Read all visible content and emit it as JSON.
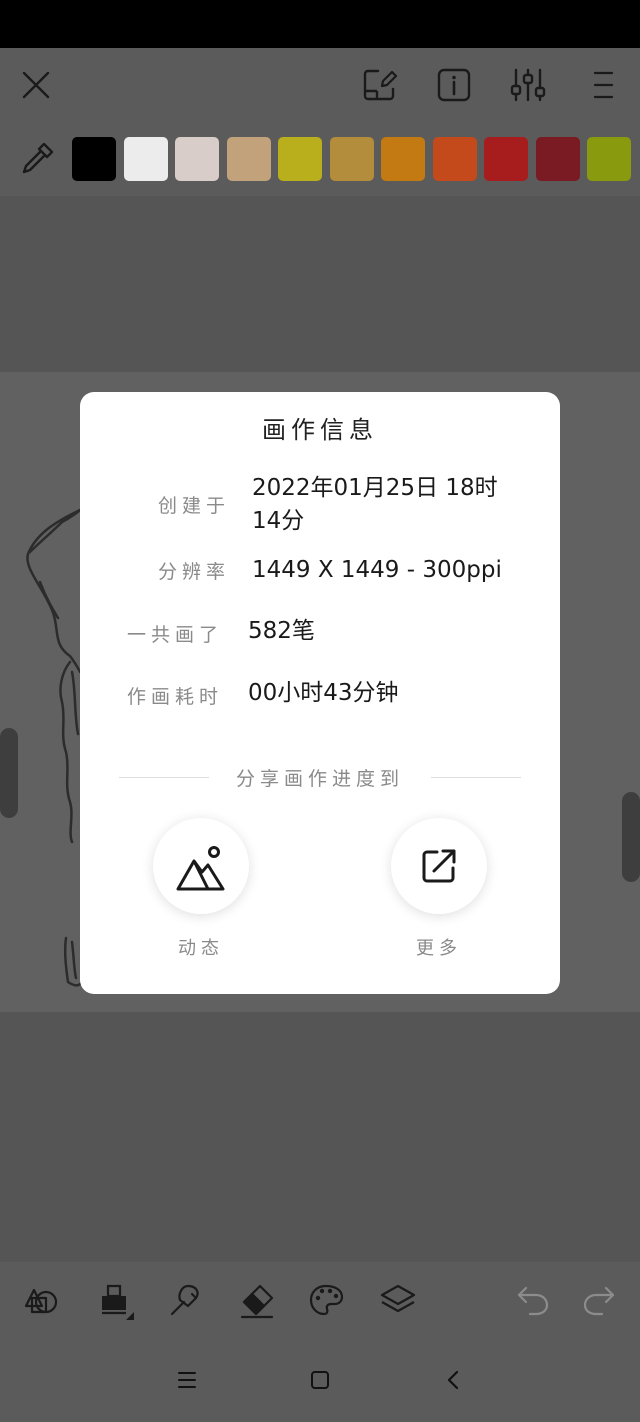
{
  "palette": {
    "colors": [
      "#000000",
      "#ececec",
      "#d8cdc8",
      "#c2a27a",
      "#b9ae1c",
      "#b48d3c",
      "#c47a12",
      "#c44a1c",
      "#a71d1d",
      "#7a1a22",
      "#8a9a0e"
    ]
  },
  "modal": {
    "title": "画作信息",
    "created_label": "创建于",
    "created_value": "2022年01月25日 18时14分",
    "resolution_label": "分辨率",
    "resolution_value": "1449 X 1449 - 300ppi",
    "strokes_label": "一共画了",
    "strokes_value": "582笔",
    "duration_label": "作画耗时",
    "duration_value": "00小时43分钟",
    "share_heading": "分享画作进度到",
    "share_moments_label": "动态",
    "share_more_label": "更多"
  },
  "icons": {
    "top": [
      "close-icon",
      "tablet-edit-icon",
      "info-icon",
      "sliders-icon",
      "menu-icon"
    ],
    "palette": "eyedropper-icon",
    "bottom": [
      "shapes-icon",
      "brush-stamp-icon",
      "smudge-icon",
      "eraser-icon",
      "color-palette-icon",
      "layers-icon",
      "undo-icon",
      "redo-icon"
    ],
    "nav": [
      "nav-menu-icon",
      "nav-home-icon",
      "nav-back-icon"
    ]
  }
}
